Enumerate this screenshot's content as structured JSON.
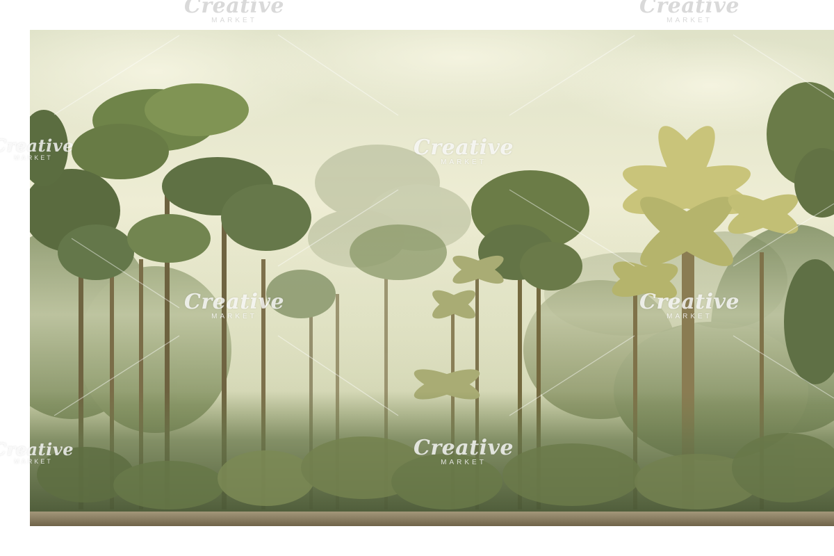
{
  "watermark": {
    "brand": "Creative",
    "sub": "MARKET"
  },
  "colors": {
    "sky_light": "#eeedd4",
    "haze": "#d9dcc0",
    "canopy_dark": "#5f7144",
    "canopy_light": "#8a9a62",
    "palm_yellow": "#c9c47a",
    "trunk": "#8a7a52",
    "ground": "#8a7c5c"
  }
}
